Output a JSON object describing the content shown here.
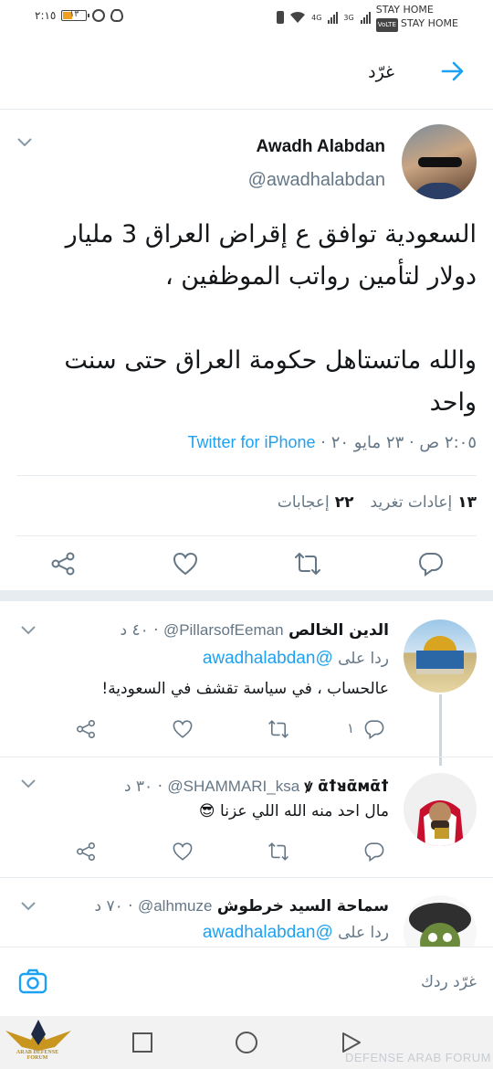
{
  "status_bar": {
    "time": "٢:١٥",
    "battery": "١٣",
    "network_1": "4G",
    "network_2": "3G",
    "carrier_1": "STAY HOME",
    "carrier_2": "STAY HOME",
    "volte": "VoLTE"
  },
  "header": {
    "title": "غرّد",
    "accent": "#1da1f2"
  },
  "tweet": {
    "author_name": "Awadh Alabdan",
    "author_handle": "@awadhalabdan",
    "text": "السعودية توافق ع إقراض العراق 3 مليار دولار لتأمين رواتب الموظفين ،\n\nوالله ماتستاهل حكومة العراق حتى سنت واحد",
    "timestamp": "٢:٠٥ ص · ٢٣ مايو ٢٠",
    "source": "Twitter for iPhone",
    "retweets_count": "١٣",
    "retweets_label": "إعادات تغريد",
    "likes_count": "٢٢",
    "likes_label": "إعجابات"
  },
  "replies": [
    {
      "name": "الدين الخالص",
      "handle": "@PillarsofEeman",
      "time": "٤٠ د",
      "reply_to_label": "ردا على",
      "reply_to_handle": "@awadhalabdan",
      "text": "عالحساب ، في سياسة تقشف في السعودية!",
      "reply_count": "١"
    },
    {
      "name": "ꝟ ᾱꝉᴚᾱᴍᾱꝉ",
      "handle": "@SHAMMARI_ksa",
      "time": "٣٠ د",
      "text": "مال احد منه الله اللي عزنا 😎"
    },
    {
      "name": "سماحة السيد خرطوش",
      "handle": "@alhmuze",
      "time": "٧٠ د",
      "reply_to_label": "ردا على",
      "reply_to_handle": "@awadhalabdan"
    }
  ],
  "compose": {
    "placeholder": "غرّد ردك"
  },
  "watermark": {
    "text": "DEFENSE ARAB FORUM",
    "logo_text": "ARAB DEFENSE FORUM"
  }
}
